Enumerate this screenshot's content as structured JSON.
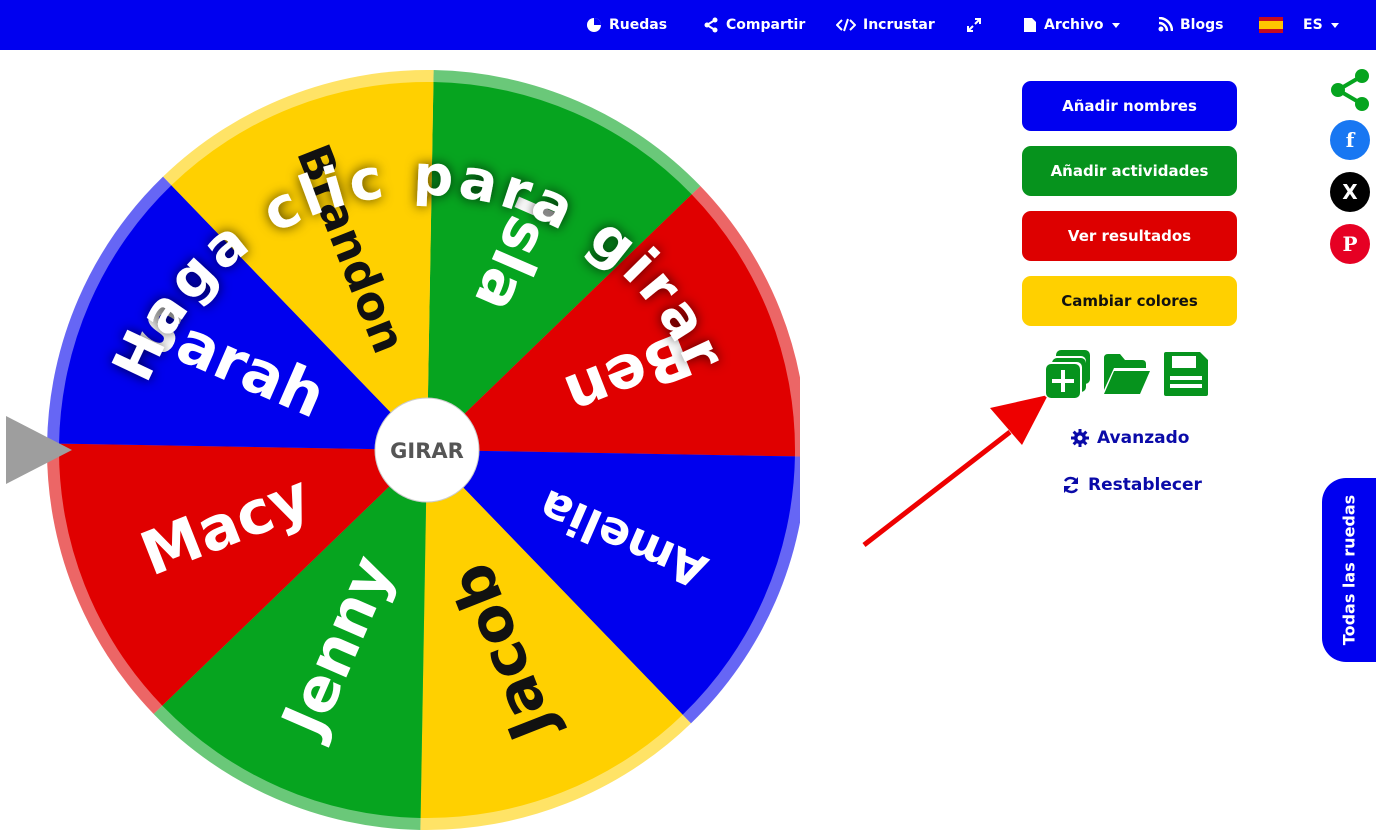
{
  "nav": {
    "wheels": "Ruedas",
    "share": "Compartir",
    "embed": "Incrustar",
    "file": "Archivo",
    "blogs": "Blogs",
    "language": "ES"
  },
  "actions": {
    "add_names": "Añadir nombres",
    "add_activities": "Añadir actividades",
    "view_results": "Ver resultados",
    "change_colors": "Cambiar colores",
    "advanced": "Avanzado",
    "reset": "Restablecer"
  },
  "side_tab": "Todas las ruedas",
  "wheel": {
    "center_label": "GIRAR",
    "overlay_text": "Haga clic para girar",
    "segments": [
      {
        "name": "Brandon",
        "color": "#ffd000"
      },
      {
        "name": "Isla",
        "color": "#06a41f"
      },
      {
        "name": "Ben",
        "color": "#e00000"
      },
      {
        "name": "Amelia",
        "color": "#0000ee"
      },
      {
        "name": "Jacob",
        "color": "#ffd000"
      },
      {
        "name": "Jenny",
        "color": "#06a41f"
      },
      {
        "name": "Macy",
        "color": "#e00000"
      },
      {
        "name": "Sarah",
        "color": "#0000ee"
      }
    ]
  },
  "colors": {
    "brand_blue": "#0000f0",
    "green": "#06a41f",
    "red": "#e00000",
    "yellow": "#ffd000",
    "link": "#0a0aa8"
  }
}
